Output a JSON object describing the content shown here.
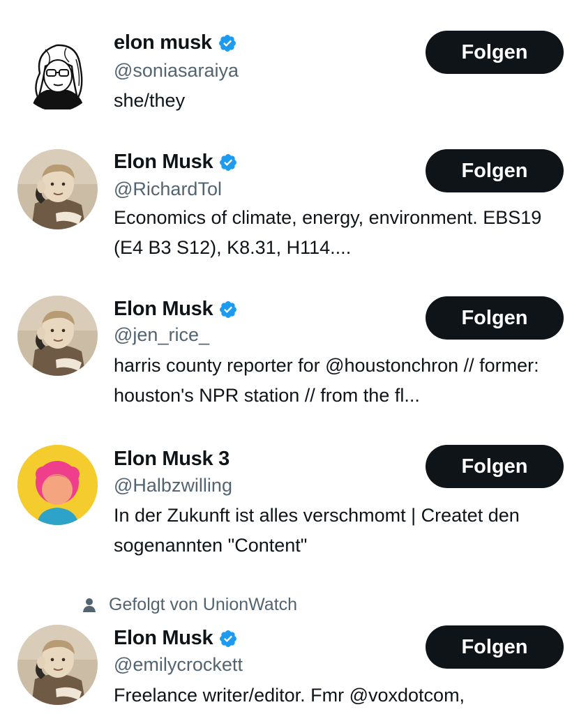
{
  "accounts": [
    {
      "name": "elon musk",
      "verified": true,
      "handle": "@soniasaraiya",
      "bio": "she/they",
      "button": "Folgen",
      "avatar": "sketch-woman-portrait"
    },
    {
      "name": "Elon Musk",
      "verified": true,
      "handle": "@RichardTol",
      "bio": "Economics of climate, energy, environment. EBS19 (E4 B3 S12), K8.31, H114....",
      "button": "Folgen",
      "avatar": "child-with-telephone-photo"
    },
    {
      "name": "Elon Musk",
      "verified": true,
      "handle": "@jen_rice_",
      "bio": "harris county reporter for @houstonchron // former: houston's NPR station // from the fl...",
      "button": "Folgen",
      "avatar": "child-with-telephone-photo"
    },
    {
      "name": "Elon Musk 3",
      "verified": false,
      "handle": "@Halbzwilling",
      "bio": "In der Zukunft ist alles verschmomt | Createt den sogenannten \"Content\"",
      "button": "Folgen",
      "avatar": "pink-hair-cartoon-avatar"
    },
    {
      "name": "Elon Musk",
      "verified": true,
      "handle": "@emilycrockett",
      "bio": "Freelance writer/editor. Fmr @voxdotcom,",
      "button": "Folgen",
      "avatar": "child-with-telephone-photo",
      "social_context": "Gefolgt von UnionWatch"
    }
  ],
  "colors": {
    "text": "#0f1419",
    "secondary": "#536471",
    "verified_badge": "#1d9bf0",
    "button_bg": "#0f1419",
    "button_text": "#ffffff"
  }
}
